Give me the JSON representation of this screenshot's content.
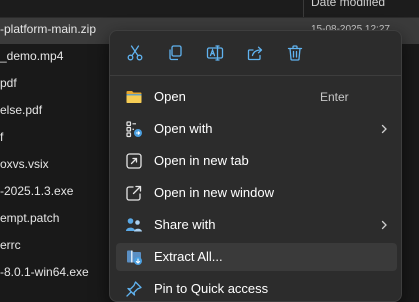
{
  "file_list": {
    "column_header": "Date modified",
    "rows": [
      {
        "name": "-platform-main.zip",
        "date": "15-08-2025 12:27",
        "selected": true
      },
      {
        "name": "_demo.mp4",
        "date": ""
      },
      {
        "name": "pdf",
        "date": ""
      },
      {
        "name": "else.pdf",
        "date": ""
      },
      {
        "name": "f",
        "date": ""
      },
      {
        "name": "oxvs.vsix",
        "date": ""
      },
      {
        "name": "-2025.1.3.exe",
        "date": ""
      },
      {
        "name": "empt.patch",
        "date": ""
      },
      {
        "name": "errc",
        "date": ""
      },
      {
        "name": "-8.0.1-win64.exe",
        "date": ""
      }
    ]
  },
  "context_menu": {
    "quick_actions": [
      {
        "name": "cut",
        "icon": "scissors-icon"
      },
      {
        "name": "copy",
        "icon": "copy-icon"
      },
      {
        "name": "rename",
        "icon": "rename-icon"
      },
      {
        "name": "share",
        "icon": "share-icon"
      },
      {
        "name": "delete",
        "icon": "trash-icon"
      }
    ],
    "items": [
      {
        "label": "Open",
        "shortcut": "Enter",
        "icon": "folder-icon",
        "submenu": false
      },
      {
        "label": "Open with",
        "shortcut": "",
        "icon": "open-with-icon",
        "submenu": true
      },
      {
        "label": "Open in new tab",
        "shortcut": "",
        "icon": "new-tab-icon",
        "submenu": false
      },
      {
        "label": "Open in new window",
        "shortcut": "",
        "icon": "new-window-icon",
        "submenu": false
      },
      {
        "label": "Share with",
        "shortcut": "",
        "icon": "share-with-icon",
        "submenu": true
      },
      {
        "label": "Extract All...",
        "shortcut": "",
        "icon": "extract-icon",
        "submenu": false,
        "highlighted": true
      },
      {
        "label": "Pin to Quick access",
        "shortcut": "",
        "icon": "pin-icon",
        "submenu": false
      }
    ]
  },
  "colors": {
    "background": "#191919",
    "menu_background": "#2c2c2c",
    "selected_row": "#3b3b3b",
    "highlight": "#3a3a3a",
    "icon_blue": "#60b3f0",
    "folder_yellow": "#f2c94c"
  }
}
